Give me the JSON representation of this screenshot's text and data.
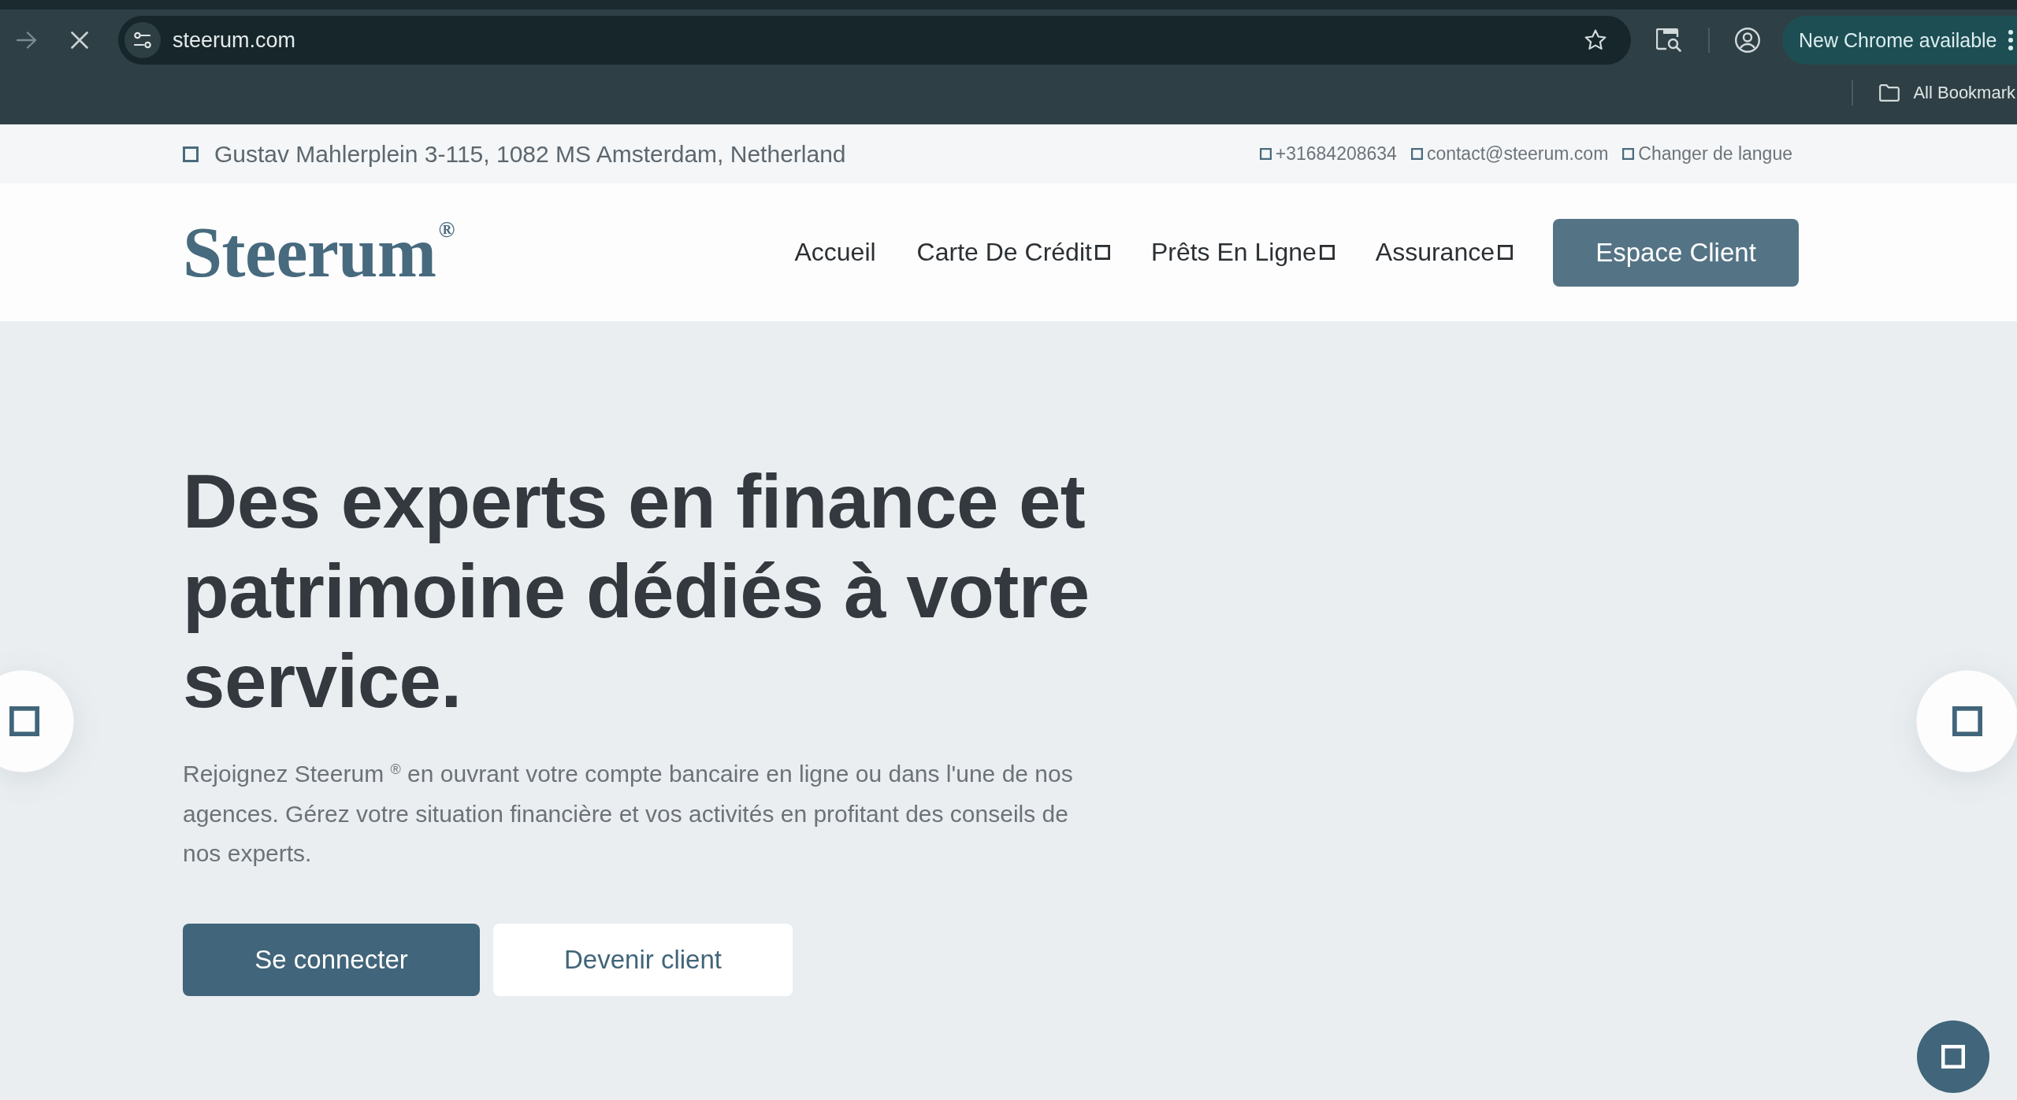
{
  "browser": {
    "url": "steerum.com",
    "update_button": "New Chrome available",
    "bookmarks_bar": {
      "folder": "All Bookmark"
    }
  },
  "top_bar": {
    "address": "Gustav Mahlerplein 3-115, 1082 MS Amsterdam, Netherland",
    "links": [
      {
        "label": "+31684208634"
      },
      {
        "label": "contact@steerum.com"
      },
      {
        "label": "Changer de langue"
      }
    ]
  },
  "header": {
    "logo": {
      "name": "Steerum",
      "mark": "®"
    },
    "nav": [
      {
        "label": "Accueil",
        "dropdown": false
      },
      {
        "label": "Carte De Crédit",
        "dropdown": true
      },
      {
        "label": "Prêts En Ligne",
        "dropdown": true
      },
      {
        "label": "Assurance",
        "dropdown": true
      }
    ],
    "cta": "Espace Client"
  },
  "hero": {
    "title": "Des experts en finance et patrimoine dédiés à votre service.",
    "text": "Rejoignez Steerum $^{®}$ en ouvrant votre compte bancaire en ligne ou dans l'une de nos agences. Gérez votre situation financière et vos activités en profitant des conseils de nos experts.",
    "buttons": [
      {
        "label": "Se connecter",
        "kind": "primary"
      },
      {
        "label": "Devenir client",
        "kind": "secondary"
      }
    ]
  }
}
